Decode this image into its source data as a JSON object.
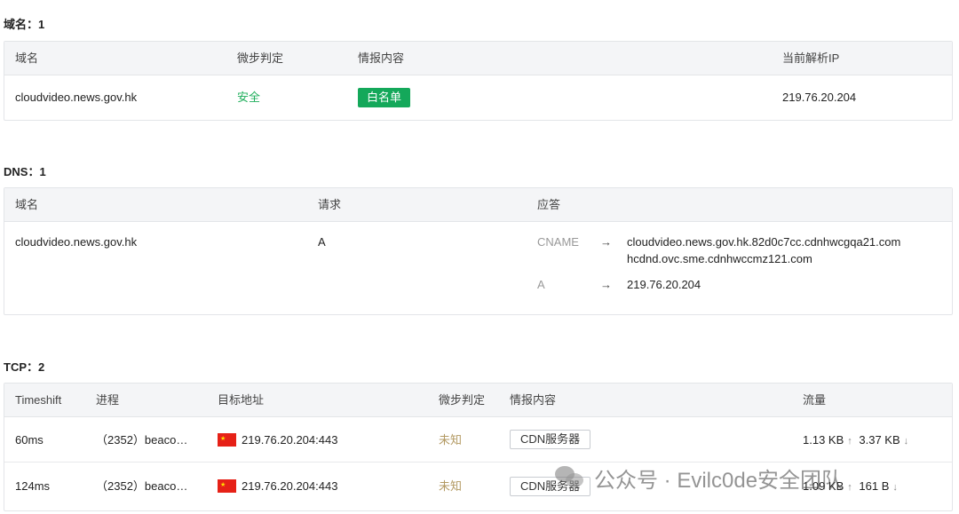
{
  "domain_section": {
    "title": "域名：1",
    "headers": [
      "域名",
      "微步判定",
      "情报内容",
      "当前解析IP"
    ],
    "row": {
      "domain": "cloudvideo.news.gov.hk",
      "verdict": "安全",
      "intel": "白名单",
      "ip": "219.76.20.204"
    }
  },
  "dns_section": {
    "title": "DNS：1",
    "headers": [
      "域名",
      "请求",
      "应答"
    ],
    "row": {
      "domain": "cloudvideo.news.gov.hk",
      "request": "A",
      "answers": [
        {
          "type": "CNAME",
          "arrow": "→",
          "values": [
            "cloudvideo.news.gov.hk.82d0c7cc.cdnhwcgqa21.com",
            "hcdnd.ovc.sme.cdnhwccmz121.com"
          ]
        },
        {
          "type": "A",
          "arrow": "→",
          "values": [
            "219.76.20.204"
          ]
        }
      ]
    }
  },
  "tcp_section": {
    "title": "TCP：2",
    "headers": [
      "Timeshift",
      "进程",
      "目标地址",
      "微步判定",
      "情报内容",
      "流量"
    ],
    "rows": [
      {
        "timeshift": "60ms",
        "process": "（2352）beaco…",
        "target": "219.76.20.204:443",
        "verdict": "未知",
        "intel": "CDN服务器",
        "upload": "1.13 KB",
        "download": "3.37 KB"
      },
      {
        "timeshift": "124ms",
        "process": "（2352）beaco…",
        "target": "219.76.20.204:443",
        "verdict": "未知",
        "intel": "CDN服务器",
        "upload": "1.09 KB",
        "download": "161 B"
      }
    ]
  },
  "icons": {
    "upload": "↑",
    "download": "↓",
    "flag": "china-flag-icon"
  },
  "colors": {
    "safe": "#1fae5b",
    "whitelist_bg": "#14a85a",
    "unknown": "#b39a63",
    "flag": "#e62117"
  },
  "watermark": {
    "text": "公众号 · Evilc0de安全团队"
  }
}
